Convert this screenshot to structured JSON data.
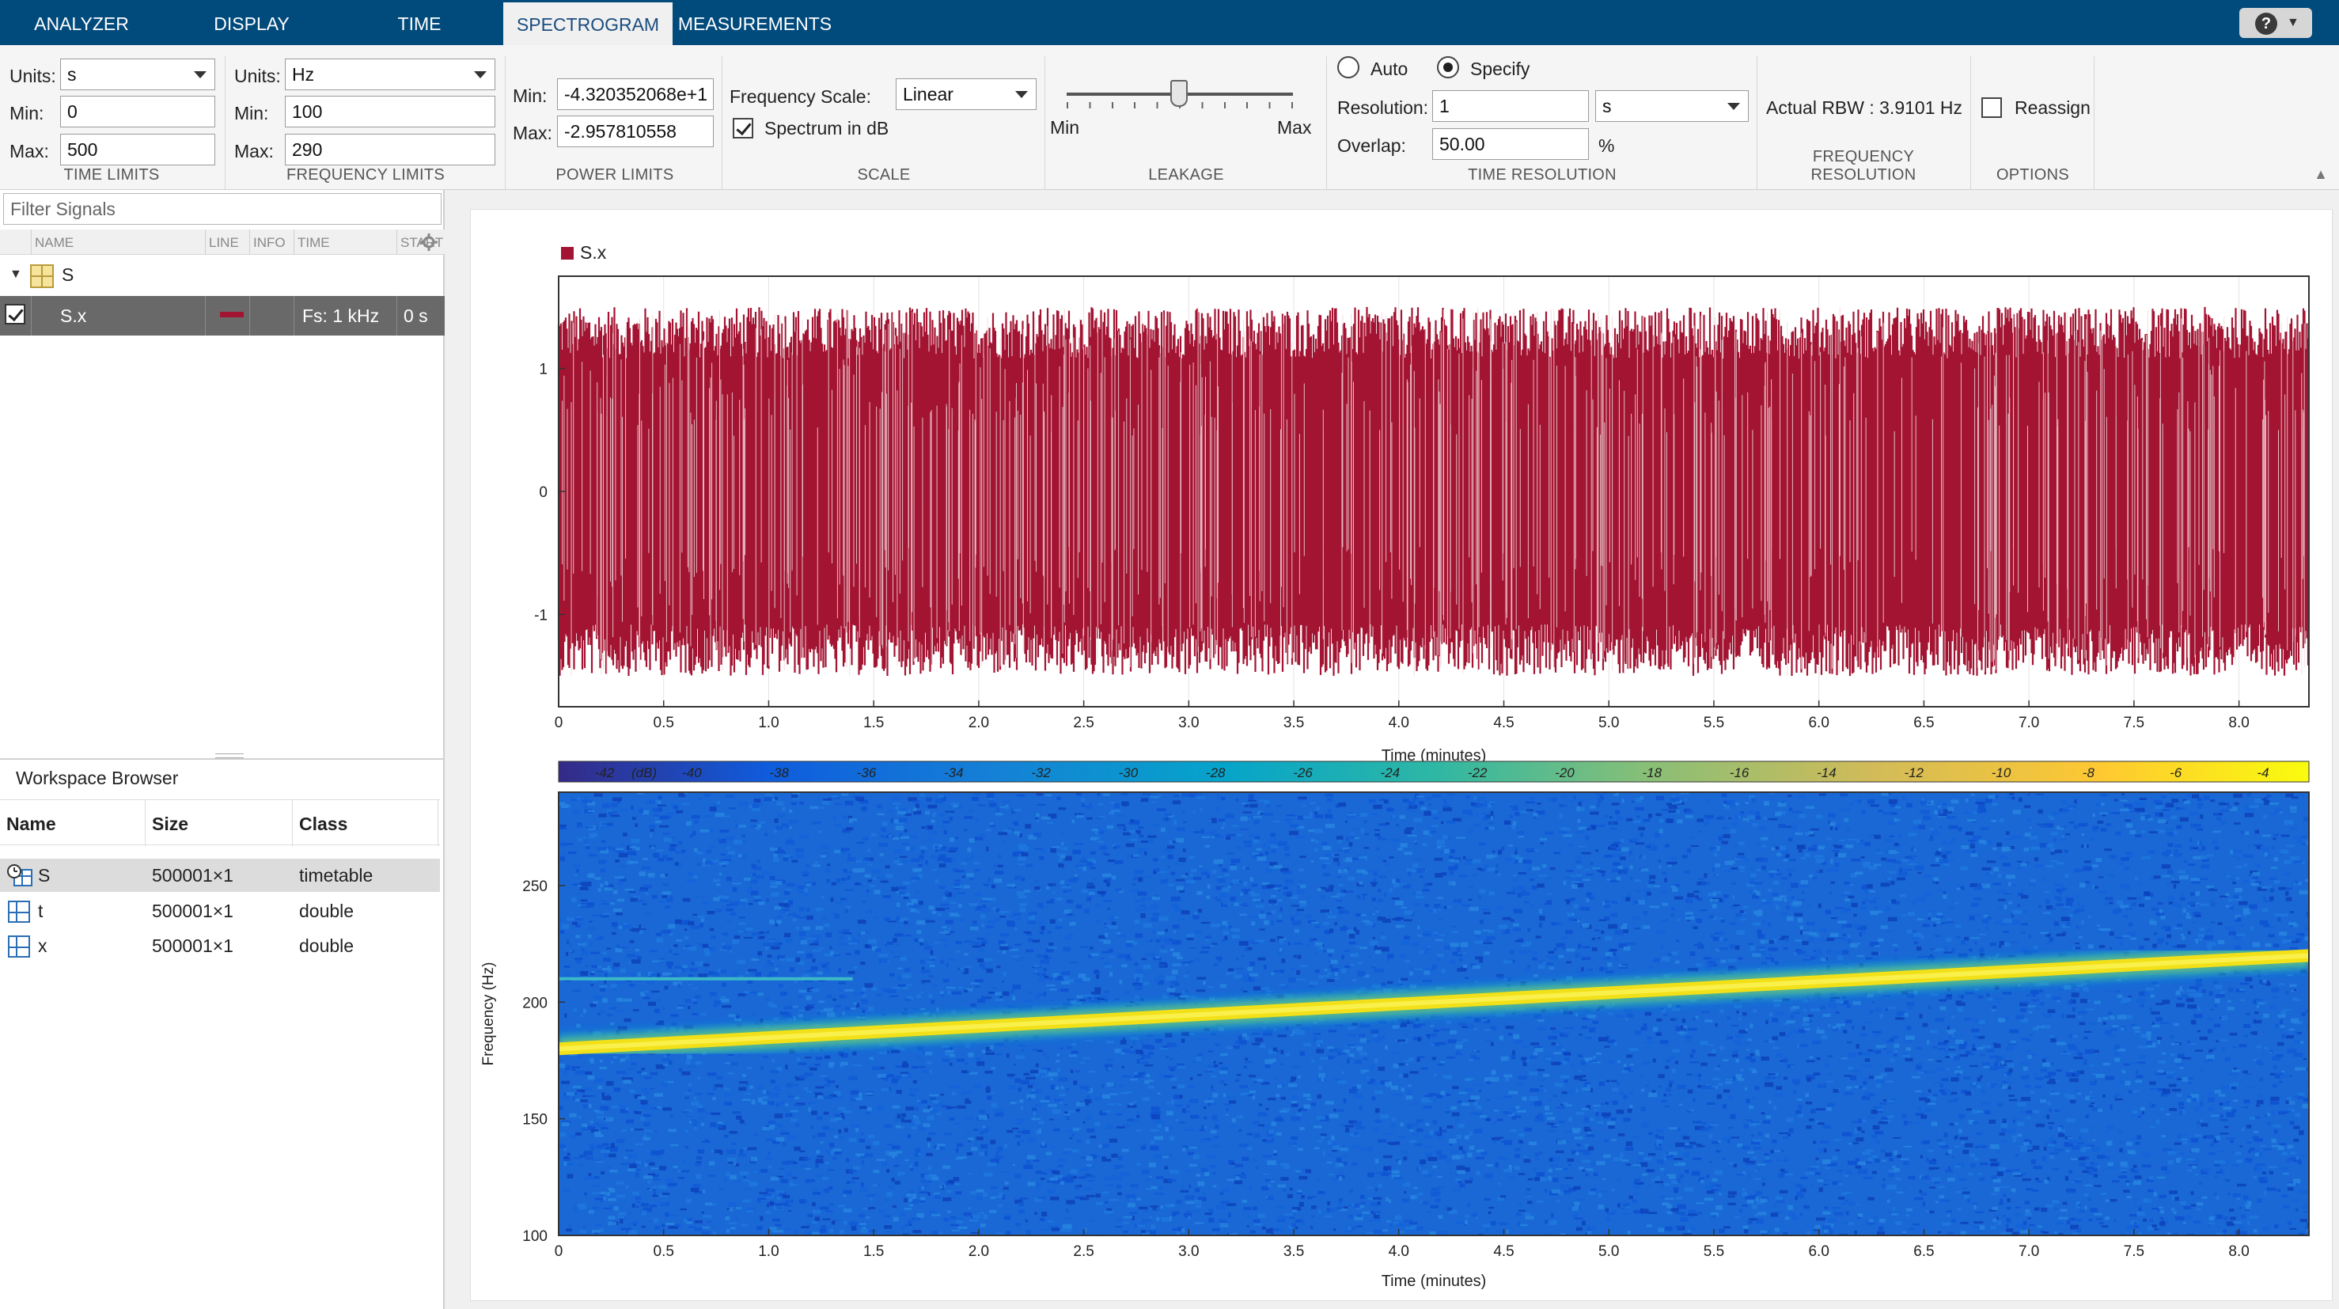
{
  "tabs": [
    {
      "label": "ANALYZER",
      "active": false
    },
    {
      "label": "DISPLAY",
      "active": false
    },
    {
      "label": "TIME",
      "active": false
    },
    {
      "label": "SPECTROGRAM",
      "active": true
    },
    {
      "label": "MEASUREMENTS",
      "active": false
    }
  ],
  "time_limits": {
    "title": "TIME LIMITS",
    "units_label": "Units:",
    "units_value": "s",
    "min_label": "Min:",
    "min_value": "0",
    "max_label": "Max:",
    "max_value": "500"
  },
  "frequency_limits": {
    "title": "FREQUENCY LIMITS",
    "units_label": "Units:",
    "units_value": "Hz",
    "min_label": "Min:",
    "min_value": "100",
    "max_label": "Max:",
    "max_value": "290"
  },
  "power_limits": {
    "title": "POWER LIMITS",
    "min_label": "Min:",
    "min_value": "-4.320352068e+1",
    "max_label": "Max:",
    "max_value": "-2.957810558"
  },
  "scale": {
    "title": "SCALE",
    "freq_scale_label": "Frequency Scale:",
    "freq_scale_value": "Linear",
    "spectrum_db_label": "Spectrum in dB",
    "spectrum_db_checked": true
  },
  "leakage": {
    "title": "LEAKAGE",
    "min_label": "Min",
    "max_label": "Max",
    "level": 0.4
  },
  "time_resolution": {
    "title": "TIME RESOLUTION",
    "auto_label": "Auto",
    "specify_label": "Specify",
    "selected": "Specify",
    "resolution_label": "Resolution:",
    "resolution_value": "1",
    "resolution_units": "s",
    "overlap_label": "Overlap:",
    "overlap_value": "50.00",
    "overlap_unit": "%"
  },
  "frequency_resolution": {
    "title": "FREQUENCY RESOLUTION",
    "actual_rbw": "Actual RBW : 3.9101 Hz"
  },
  "options": {
    "title": "OPTIONS",
    "reassign_label": "Reassign",
    "reassign_checked": false
  },
  "signal_table": {
    "filter_placeholder": "Filter Signals",
    "columns": [
      "NAME",
      "LINE",
      "INFO",
      "TIME",
      "START"
    ],
    "group": "S",
    "signal": {
      "name": "S.x",
      "info": "Fs: 1 kHz",
      "time": "0 s",
      "line_color": "#a31432",
      "checked": true
    }
  },
  "workspace": {
    "title": "Workspace Browser",
    "columns": [
      "Name",
      "Size",
      "Class"
    ],
    "rows": [
      {
        "name": "S",
        "size": "500001×1",
        "class": "timetable"
      },
      {
        "name": "t",
        "size": "500001×1",
        "class": "double"
      },
      {
        "name": "x",
        "size": "500001×1",
        "class": "double"
      }
    ]
  },
  "colors": {
    "signal": "#a31432",
    "accent": "#004a7c"
  },
  "chart_data": [
    {
      "type": "line",
      "legend": [
        "S.x"
      ],
      "xlabel": "Time (minutes)",
      "ylabel": "",
      "xlim": [
        0,
        8.333
      ],
      "ylim": [
        -1.75,
        1.75
      ],
      "xticks": [
        "0",
        "0.5",
        "1.0",
        "1.5",
        "2.0",
        "2.5",
        "3.0",
        "3.5",
        "4.0",
        "4.5",
        "5.0",
        "5.5",
        "6.0",
        "6.5",
        "7.0",
        "7.5",
        "8.0"
      ],
      "yticks": [
        "1",
        "0",
        "-1"
      ],
      "envelope": {
        "max": 1.5,
        "min": -1.5
      },
      "grid": true
    },
    {
      "type": "heatmap",
      "xlabel": "Time (minutes)",
      "ylabel": "Frequency (Hz)",
      "xlim": [
        0,
        8.333
      ],
      "ylim": [
        100,
        290
      ],
      "xticks": [
        "0",
        "0.5",
        "1.0",
        "1.5",
        "2.0",
        "2.5",
        "3.0",
        "3.5",
        "4.0",
        "4.5",
        "5.0",
        "5.5",
        "6.0",
        "6.5",
        "7.0",
        "7.5",
        "8.0"
      ],
      "yticks": [
        "250",
        "200",
        "150",
        "100"
      ],
      "colorbar_unit": "dB",
      "colorbar_ticks": [
        "-42",
        "-40",
        "-38",
        "-36",
        "-34",
        "-32",
        "-30",
        "-28",
        "-26",
        "-24",
        "-22",
        "-20",
        "-18",
        "-16",
        "-14",
        "-12",
        "-10",
        "-8",
        "-6",
        "-4"
      ],
      "chirp": {
        "start_time_min": 0,
        "start_freq_hz": 180,
        "end_time_min": 8.333,
        "end_freq_hz": 220
      },
      "tone": {
        "start_time_min": 0,
        "end_time_min": 1.4,
        "freq_hz": 210
      }
    }
  ]
}
